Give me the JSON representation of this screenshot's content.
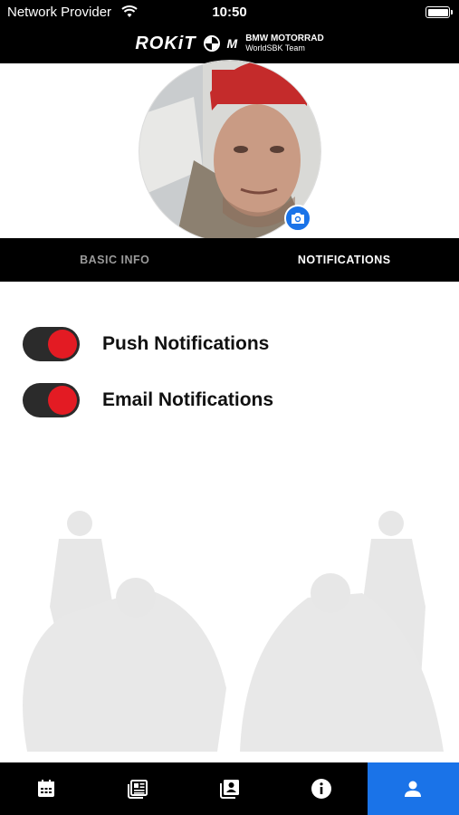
{
  "status_bar": {
    "carrier": "Network Provider",
    "time": "10:50"
  },
  "header": {
    "brand": "ROKiT",
    "partner_line1": "BMW MOTORRAD",
    "partner_line2": "WorldSBK Team",
    "m_mark": "M"
  },
  "tabs": [
    {
      "label": "BASIC INFO",
      "active": false
    },
    {
      "label": "NOTIFICATIONS",
      "active": true
    }
  ],
  "settings": [
    {
      "label": "Push Notifications",
      "enabled": true
    },
    {
      "label": "Email Notifications",
      "enabled": true
    }
  ],
  "colors": {
    "accent": "#1a73e8",
    "toggle_on": "#e31b23",
    "toggle_track": "#2b2b2b",
    "bar": "#000000"
  },
  "bottom_nav": [
    {
      "icon": "calendar-icon",
      "active": false
    },
    {
      "icon": "news-icon",
      "active": false
    },
    {
      "icon": "contacts-icon",
      "active": false
    },
    {
      "icon": "info-icon",
      "active": false
    },
    {
      "icon": "profile-icon",
      "active": true
    }
  ]
}
